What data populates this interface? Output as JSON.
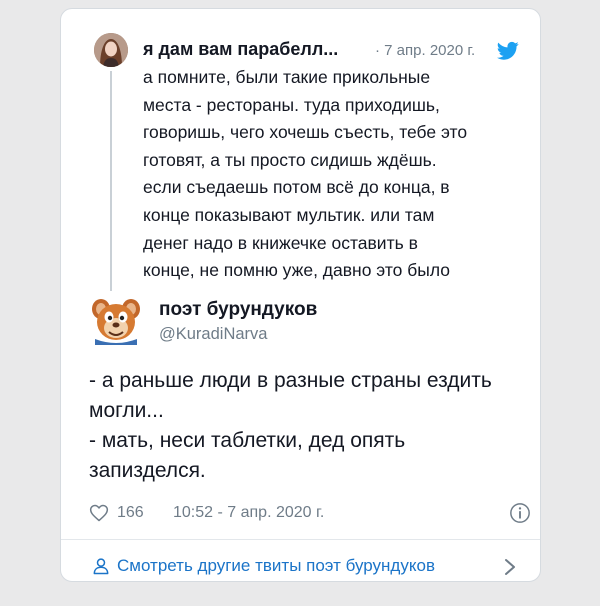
{
  "quoted": {
    "author": "я дам вам парабелл...",
    "date": "· 7 апр. 2020 г.",
    "lines": [
      "а помните, были такие прикольные",
      "места - рестораны. туда приходишь,",
      "говоришь, чего хочешь съесть, тебе это",
      "готовят, а ты просто сидишь ждёшь.",
      "если съедаешь потом всё до конца, в",
      "конце показывают мультик. или там",
      "денег надо в книжечке оставить в",
      "конце, не помню уже, давно это было"
    ]
  },
  "tweet": {
    "author": "поэт бурундуков",
    "handle": "@KuradiNarva",
    "lines": [
      "- а раньше люди в разные страны ездить",
      "могли...",
      "- мать, неси таблетки, дед опять",
      "запизделся."
    ],
    "likes": "166",
    "timestamp": "10:52 - 7 апр. 2020 г."
  },
  "footer": {
    "more_label": "Смотреть другие твиты поэт бурундуков"
  },
  "colors": {
    "text": "#141823",
    "muted": "#6f7c88",
    "link": "#1b74c8",
    "twitter_blue": "#1da1f2"
  },
  "icons": [
    "twitter-bird-icon",
    "heart-icon",
    "info-icon",
    "person-icon",
    "chevron-right-icon"
  ]
}
